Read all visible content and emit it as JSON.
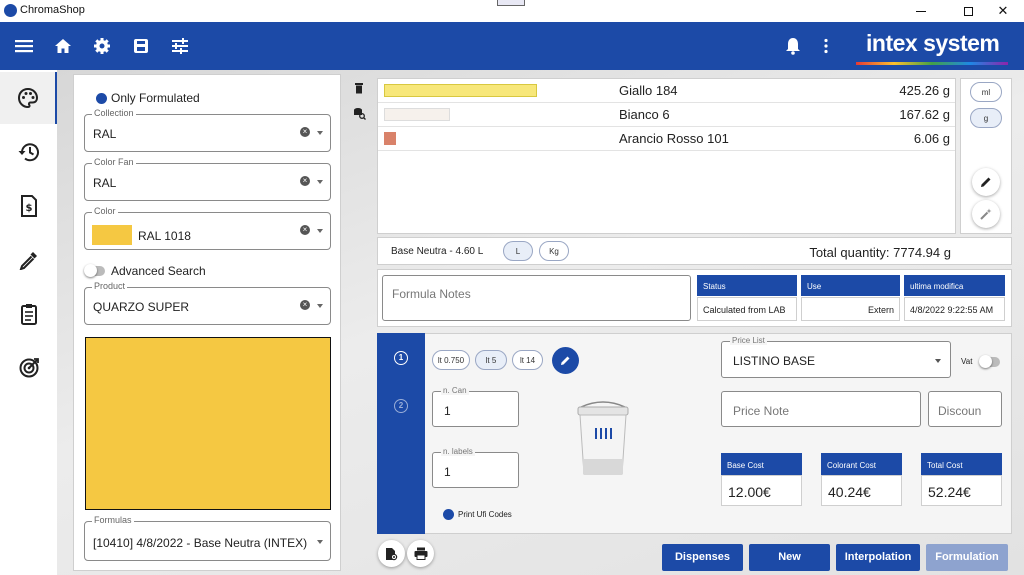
{
  "app": {
    "title": "ChromaShop",
    "brand": "intex system"
  },
  "colors": {
    "primary": "#1c4aa7",
    "selected_color": "#f5c842"
  },
  "toolbar_icons": [
    "menu-icon",
    "home-icon",
    "gear-icon",
    "save-icon",
    "sliders-icon",
    "bell-icon",
    "more-vert-icon"
  ],
  "nav_icons": [
    "palette-icon",
    "history-icon",
    "invoice-icon",
    "eyedropper-icon",
    "clipboard-icon",
    "target-icon"
  ],
  "left": {
    "only_formulated": "Only Formulated",
    "collection": {
      "label": "Collection",
      "value": "RAL"
    },
    "color_fan": {
      "label": "Color Fan",
      "value": "RAL"
    },
    "color": {
      "label": "Color",
      "value": "RAL 1018"
    },
    "advanced_search": "Advanced Search",
    "product": {
      "label": "Product",
      "value": "QUARZO SUPER"
    },
    "formulas": {
      "label": "Formulas",
      "value": "[10410] 4/8/2022 - Base Neutra (INTEX)"
    }
  },
  "colorants": [
    {
      "name": "Giallo 184",
      "qty": "425.26 g",
      "color": "#f7e77a"
    },
    {
      "name": "Bianco 6",
      "qty": "167.62 g",
      "color": "#f6f1ec"
    },
    {
      "name": "Arancio Rosso 101",
      "qty": "6.06 g",
      "color": "#d9826a"
    }
  ],
  "units": {
    "ml": "ml",
    "g": "g"
  },
  "base": {
    "label": "Base Neutra - 4.60 L",
    "unit_l": "L",
    "unit_kg": "Kg",
    "total": "Total quantity:  7774.94 g"
  },
  "notes": {
    "placeholder": "Formula Notes"
  },
  "status": {
    "status_h": "Status",
    "status_v": "Calculated from LAB",
    "use_h": "Use",
    "use_v": "Extern",
    "mod_h": "ultima modifica",
    "mod_v": "4/8/2022 9:22:55 AM"
  },
  "steps": [
    "1",
    "2"
  ],
  "cans": [
    "lt 0.750",
    "lt 5",
    "lt 14"
  ],
  "n_can": {
    "label": "n. Can",
    "value": "1"
  },
  "n_labels": {
    "label": "n. labels",
    "value": "1"
  },
  "print_ufi": "Print Ufi Codes",
  "price_list": {
    "label": "Price List",
    "value": "LISTINO BASE"
  },
  "vat": "Vat",
  "price_note": "Price Note",
  "discount": "Discoun",
  "costs": [
    {
      "label": "Base Cost",
      "value": "12.00€"
    },
    {
      "label": "Colorant Cost",
      "value": "40.24€"
    },
    {
      "label": "Total Cost",
      "value": "52.24€"
    }
  ],
  "actions": {
    "dispenses": "Dispenses",
    "new": "New",
    "interpolation": "Interpolation",
    "formulation": "Formulation"
  }
}
